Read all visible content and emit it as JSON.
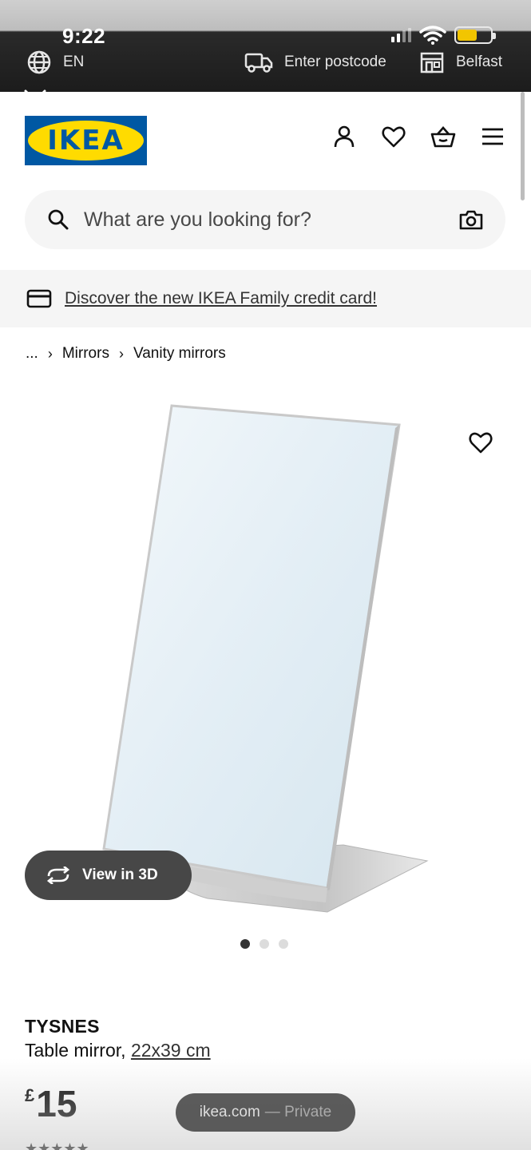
{
  "status": {
    "time": "9:22"
  },
  "utility": {
    "language": "EN",
    "postcode_label": "Enter postcode",
    "store": "Belfast"
  },
  "header": {
    "logo_text": "IKEA"
  },
  "search": {
    "placeholder": "What are you looking for?"
  },
  "promo": {
    "text": "Discover the new IKEA Family credit card!"
  },
  "breadcrumb": {
    "ellipsis": "...",
    "items": [
      "Mirrors",
      "Vanity mirrors"
    ]
  },
  "product": {
    "view3d_label": "View in 3D",
    "gallery_count": 3,
    "gallery_active": 1,
    "name": "TYSNES",
    "description": "Table mirror,",
    "dimensions": "22x39 cm",
    "currency": "£",
    "price": "15"
  },
  "browser": {
    "domain": "ikea.com",
    "mode": "— Private"
  },
  "colors": {
    "ikea_blue": "#0058a3",
    "ikea_yellow": "#ffdb00",
    "dark_pill": "#474747"
  }
}
